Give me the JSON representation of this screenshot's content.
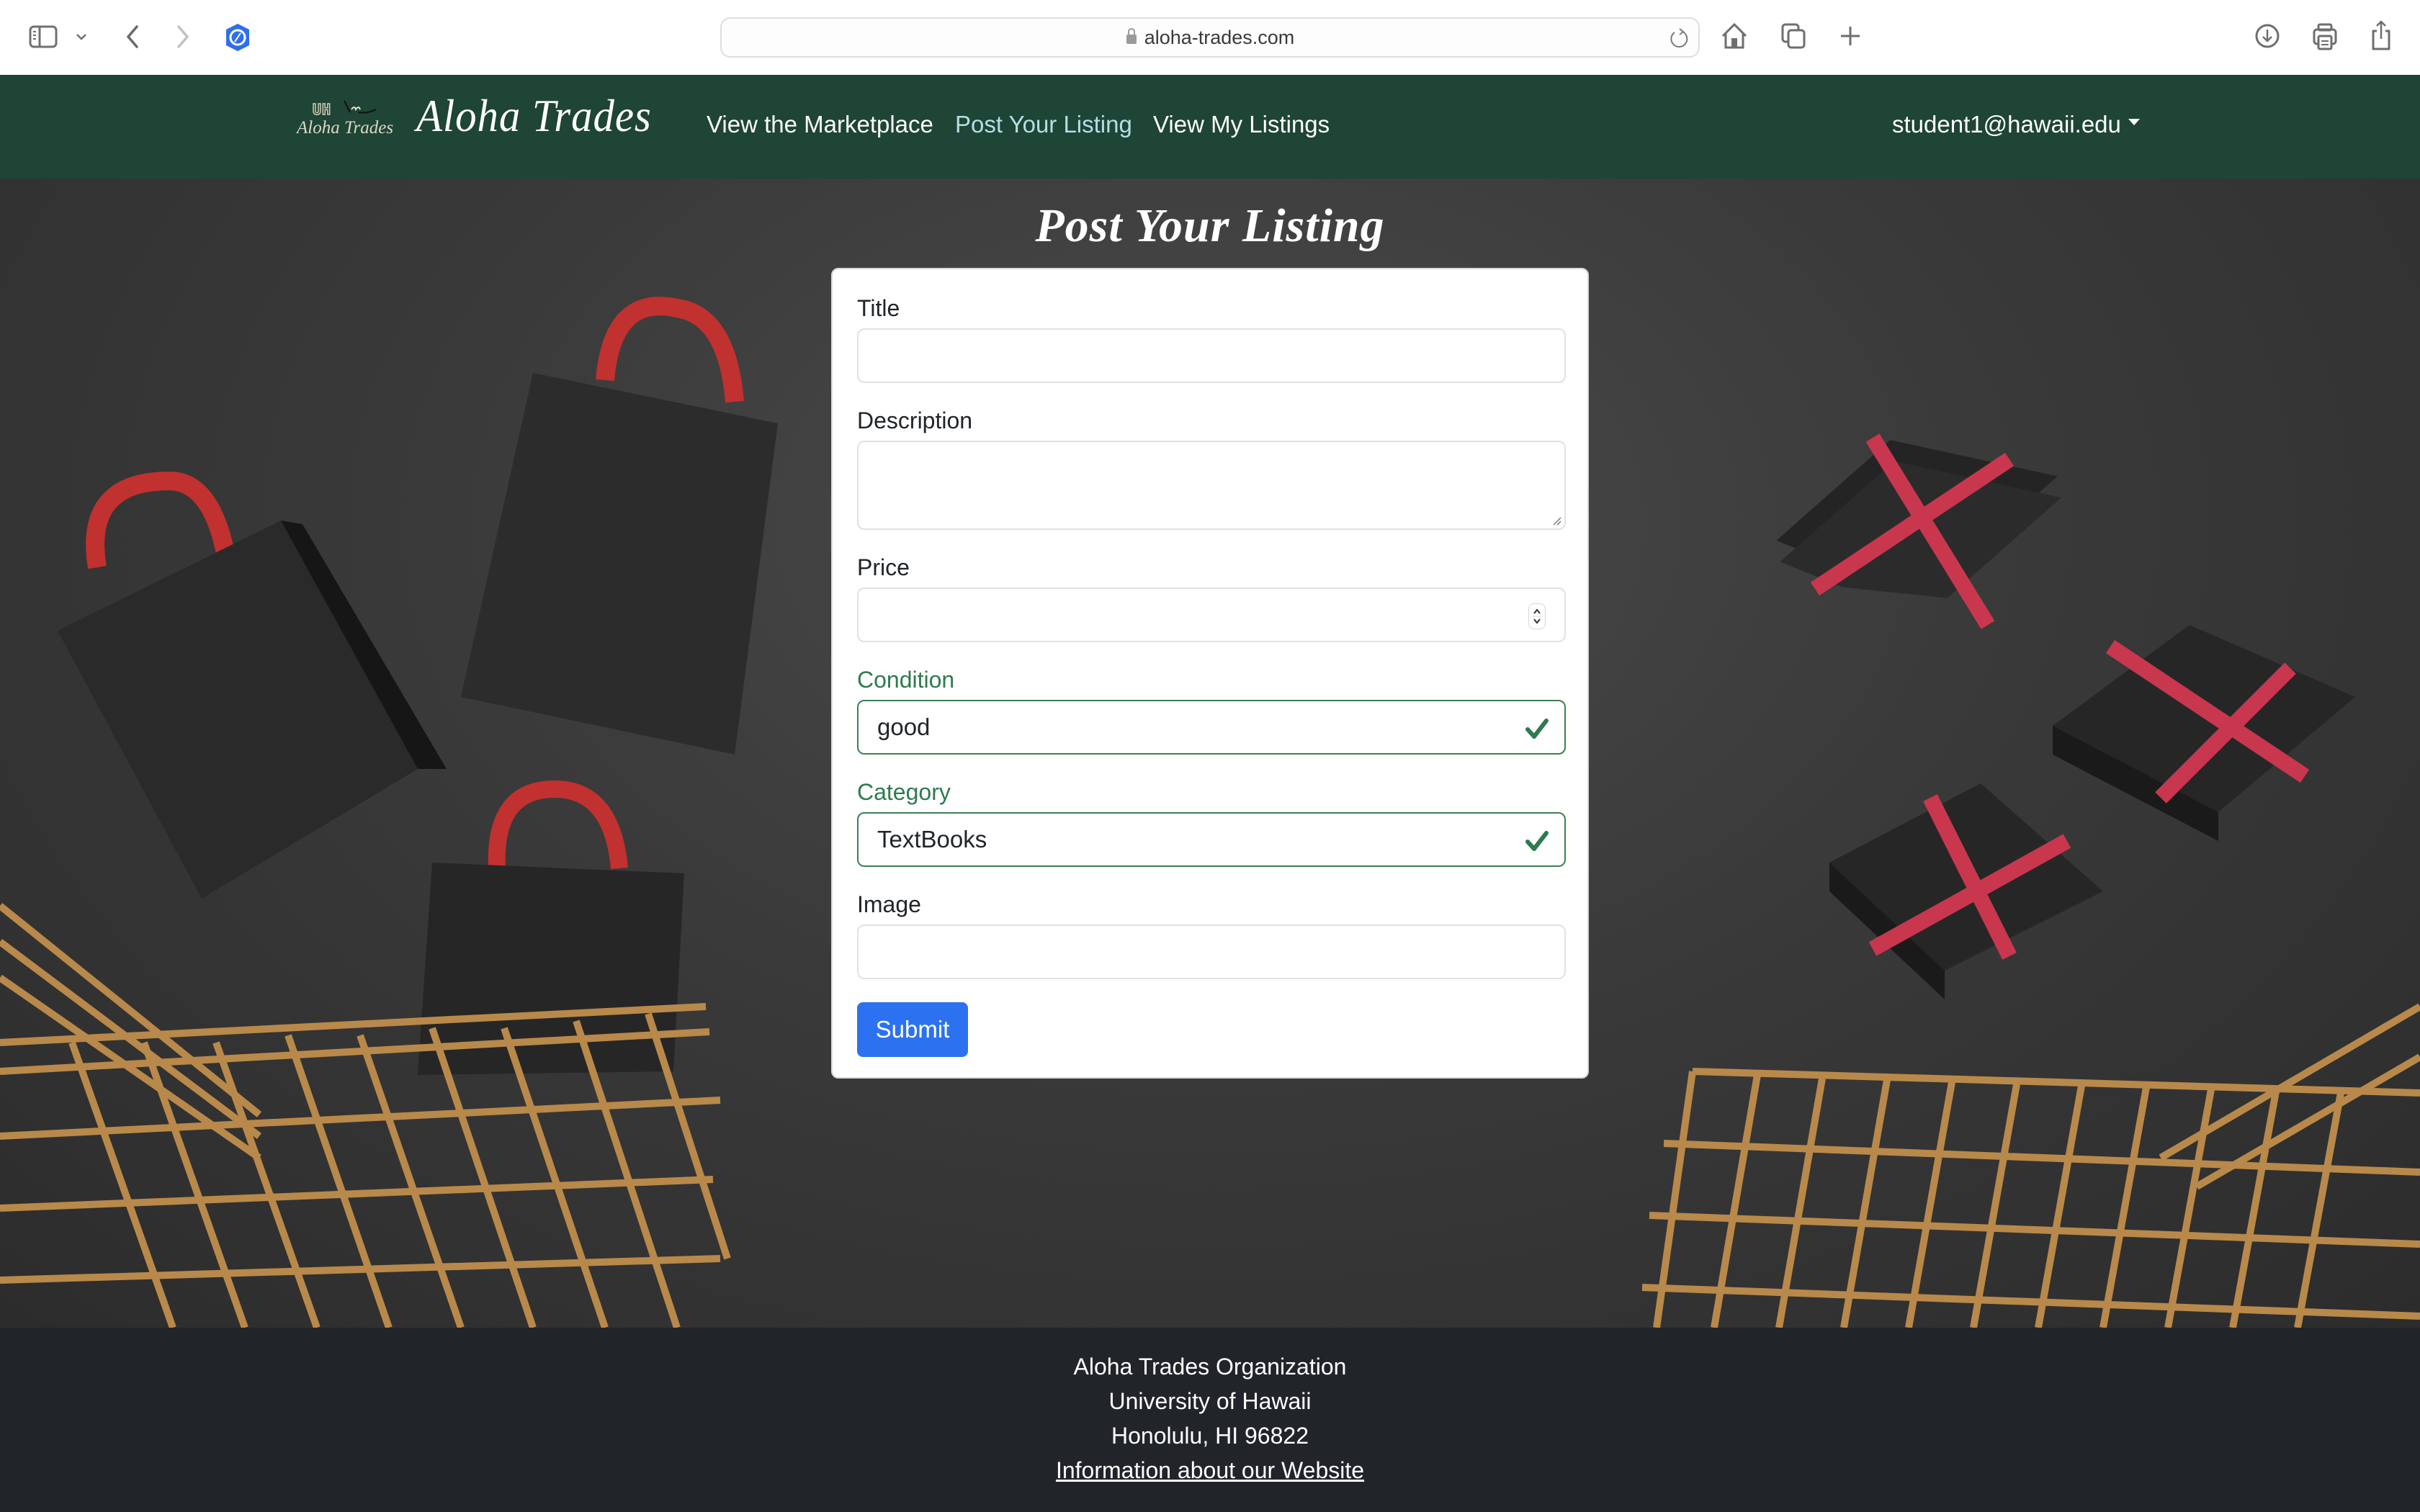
{
  "browser": {
    "url": "aloha-trades.com",
    "icons": [
      "sidebar-icon",
      "chevron-down-icon",
      "back-icon",
      "forward-icon",
      "privacy-shield-icon",
      "lock-icon",
      "reload-icon",
      "home-icon",
      "tabs-overview-icon",
      "new-tab-icon",
      "download-icon",
      "print-icon",
      "share-icon"
    ]
  },
  "navbar": {
    "logo_mark": "UH",
    "logo_text": "Aloha Trades",
    "brand": "Aloha Trades",
    "links": [
      {
        "label": "View the Marketplace",
        "active": false
      },
      {
        "label": "Post Your Listing",
        "active": true
      },
      {
        "label": "View My Listings",
        "active": false
      }
    ],
    "user": "student1@hawaii.edu",
    "colors": {
      "background": "#1e4535",
      "active_link": "#b8dde6"
    }
  },
  "page": {
    "title": "Post Your Listing"
  },
  "form": {
    "fields": {
      "title": {
        "label": "Title",
        "value": "",
        "valid": false
      },
      "description": {
        "label": "Description",
        "value": "",
        "valid": false
      },
      "price": {
        "label": "Price",
        "value": "",
        "valid": false
      },
      "condition": {
        "label": "Condition",
        "value": "good",
        "valid": true
      },
      "category": {
        "label": "Category",
        "value": "TextBooks",
        "valid": true
      },
      "image": {
        "label": "Image",
        "value": "",
        "valid": false
      }
    },
    "submit_label": "Submit",
    "colors": {
      "valid": "#2f7a4f",
      "submit": "#2c72f0"
    }
  },
  "footer": {
    "lines": [
      "Aloha Trades Organization",
      "University of Hawaii",
      "Honolulu, HI 96822"
    ],
    "link": "Information about our Website"
  }
}
